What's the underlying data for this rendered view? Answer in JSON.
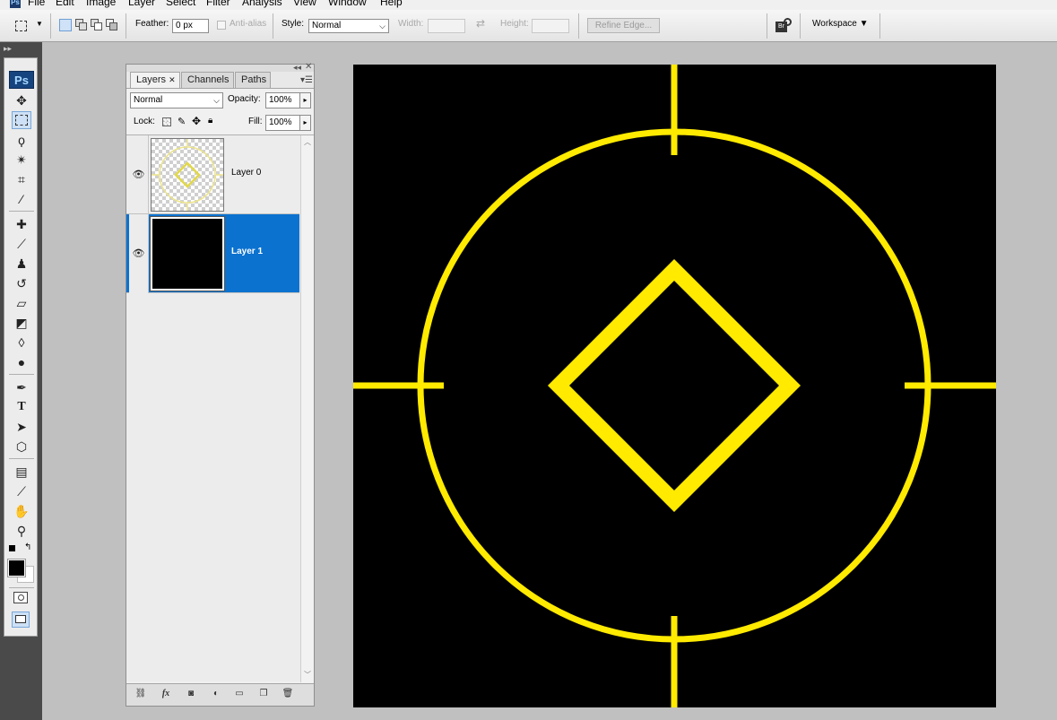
{
  "menubar": {
    "logo": "Ps",
    "items": [
      "File",
      "Edit",
      "Image",
      "Layer",
      "Select",
      "Filter",
      "Analysis",
      "View",
      "Window",
      "Help"
    ]
  },
  "options": {
    "feather_label": "Feather:",
    "feather_value": "0 px",
    "antialias_label": "Anti-alias",
    "style_label": "Style:",
    "style_value": "Normal",
    "width_label": "Width:",
    "height_label": "Height:",
    "refine_edge": "Refine Edge...",
    "workspace": "Workspace ▼"
  },
  "toolbox": {
    "logo": "Ps",
    "tools": [
      "move-tool-icon",
      "marquee-tool-icon",
      "lasso-tool-icon",
      "magic-wand-tool-icon",
      "crop-tool-icon",
      "slice-tool-icon",
      "healing-brush-tool-icon",
      "brush-tool-icon",
      "clone-stamp-tool-icon",
      "history-brush-tool-icon",
      "eraser-tool-icon",
      "paint-bucket-tool-icon",
      "blur-tool-icon",
      "dodge-tool-icon",
      "pen-tool-icon",
      "type-tool-icon",
      "path-selection-tool-icon",
      "shape-tool-icon",
      "notes-tool-icon",
      "eyedropper-tool-icon",
      "hand-tool-icon",
      "zoom-tool-icon"
    ]
  },
  "layers_panel": {
    "tabs": [
      "Layers",
      "Channels",
      "Paths"
    ],
    "active_tab": "Layers",
    "blend_mode": "Normal",
    "opacity_label": "Opacity:",
    "opacity_value": "100%",
    "lock_label": "Lock:",
    "fill_label": "Fill:",
    "fill_value": "100%",
    "layers": [
      {
        "name": "Layer 0",
        "visible": true,
        "selected": false
      },
      {
        "name": "Layer 1",
        "visible": true,
        "selected": true
      }
    ]
  },
  "colors": {
    "selection": "#0b72d0",
    "canvas_bg": "#000000",
    "crosshair": "#ffea00",
    "foreground": "#000000",
    "background": "#ffffff"
  }
}
